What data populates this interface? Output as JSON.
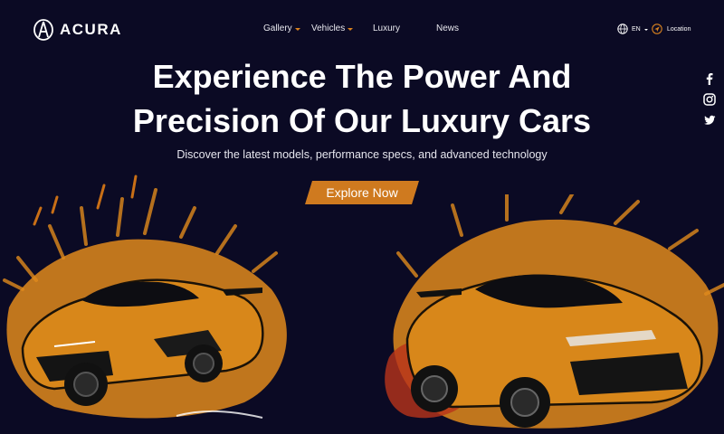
{
  "brand": {
    "name": "ACURA"
  },
  "nav": {
    "items": [
      {
        "label": "Gallery",
        "dropdown": true
      },
      {
        "label": "Vehicles",
        "dropdown": true
      },
      {
        "label": "Luxury",
        "dropdown": false
      },
      {
        "label": "News",
        "dropdown": false
      }
    ],
    "language": "EN",
    "location": "Location"
  },
  "social": [
    "facebook-icon",
    "instagram-icon",
    "twitter-icon"
  ],
  "hero": {
    "title_line1": "Experience The Power And",
    "title_line2": "Precision Of Our Luxury Cars",
    "subtitle": "Discover the latest models, performance specs, and advanced technology",
    "cta": "Explore Now"
  },
  "colors": {
    "background": "#0b0a24",
    "accent": "#cf7a1f",
    "car_orange": "#e08a1c"
  }
}
